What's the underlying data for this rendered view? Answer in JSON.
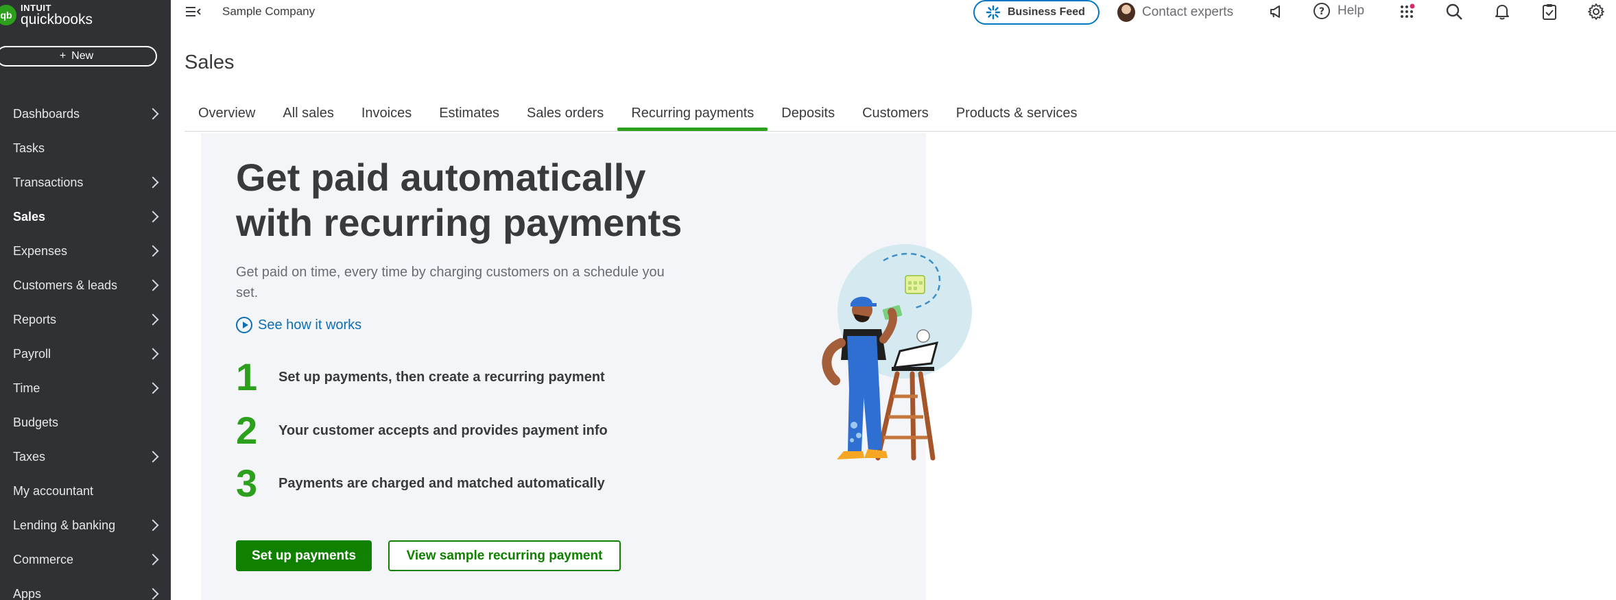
{
  "logo": {
    "mark": "qb",
    "brand_top": "INTUIT",
    "brand_bottom": "quickbooks"
  },
  "sidebar": {
    "new_label": "New",
    "items": [
      {
        "label": "Dashboards",
        "chevron": true
      },
      {
        "label": "Tasks",
        "chevron": false
      },
      {
        "label": "Transactions",
        "chevron": true
      },
      {
        "label": "Sales",
        "chevron": true,
        "active": true
      },
      {
        "label": "Expenses",
        "chevron": true
      },
      {
        "label": "Customers & leads",
        "chevron": true
      },
      {
        "label": "Reports",
        "chevron": true
      },
      {
        "label": "Payroll",
        "chevron": true
      },
      {
        "label": "Time",
        "chevron": true
      },
      {
        "label": "Budgets",
        "chevron": false
      },
      {
        "label": "Taxes",
        "chevron": true
      },
      {
        "label": "My accountant",
        "chevron": false
      },
      {
        "label": "Lending & banking",
        "chevron": true
      },
      {
        "label": "Commerce",
        "chevron": true
      },
      {
        "label": "Apps",
        "chevron": true
      }
    ]
  },
  "topbar": {
    "company": "Sample Company",
    "business_feed": "Business Feed",
    "contact_experts": "Contact experts",
    "help": "Help",
    "icons": [
      "menu-collapse-icon",
      "megaphone-icon",
      "help-icon",
      "apps-grid-icon",
      "search-icon",
      "bell-icon",
      "clipboard-icon",
      "gear-icon"
    ]
  },
  "page": {
    "title": "Sales",
    "tabs": [
      "Overview",
      "All sales",
      "Invoices",
      "Estimates",
      "Sales orders",
      "Recurring payments",
      "Deposits",
      "Customers",
      "Products & services"
    ],
    "active_tab": "Recurring payments"
  },
  "promo": {
    "headline_line1": "Get paid automatically",
    "headline_line2": "with recurring payments",
    "subtext": "Get paid on time, every time by charging customers on a schedule you set.",
    "how_link": "See how it works",
    "steps": [
      {
        "num": "1",
        "text": "Set up payments, then create a recurring payment"
      },
      {
        "num": "2",
        "text": "Your customer accepts and provides payment info"
      },
      {
        "num": "3",
        "text": "Payments are charged and matched automatically"
      }
    ],
    "primary_button": "Set up payments",
    "secondary_button": "View sample recurring payment"
  },
  "colors": {
    "sidebar_bg": "#2f3135",
    "brand_green": "#2ca01c",
    "button_green": "#108000",
    "link_blue": "#0d6eb4",
    "panel_bg": "#f4f5f8"
  }
}
